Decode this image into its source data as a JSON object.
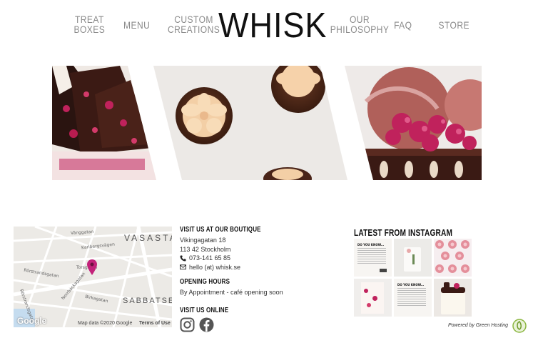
{
  "nav": {
    "treat_boxes": [
      "TREAT",
      "BOXES"
    ],
    "menu": "MENU",
    "custom_creations": [
      "CUSTOM",
      "CREATIONS"
    ],
    "logo": "WHISK",
    "our_philosophy": [
      "OUR",
      "PHILOSOPHY"
    ],
    "faq": "FAQ",
    "store": "STORE"
  },
  "map": {
    "districts": [
      "VASASTA",
      "SABBATSE"
    ],
    "streets": [
      "Vänggatan",
      "Karlbergsvägen",
      "Torsgatan",
      "Birkagatan",
      "Rörstrandsgatan",
      "Norrbackagatan",
      "Sankt Eriksgatan",
      "Rörstrandsgatan"
    ],
    "google": "Google",
    "attribution": "Map data ©2020 Google",
    "terms": "Terms of Use"
  },
  "boutique": {
    "heading": "VISIT US AT OUR BOUTIQUE",
    "street": "Vikingagatan 18",
    "city": "113 42 Stockholm",
    "phone": "073-141 65 85",
    "email": "hello (at) whisk.se"
  },
  "hours": {
    "heading": "OPENING HOURS",
    "text": "By Appointment - café opening soon"
  },
  "online": {
    "heading": "VISIT US ONLINE",
    "icons": [
      "instagram-icon",
      "facebook-icon"
    ]
  },
  "instagram": {
    "heading": "LATEST FROM INSTAGRAM",
    "tile_text": "DO YOU KNOW..."
  },
  "footer": {
    "powered_by": "Powered by Green Hosting"
  },
  "colors": {
    "nav_text": "#8a8a8a",
    "logo": "#111111",
    "map_pin": "#c2227a",
    "raspberry": "#c0225c",
    "chocolate": "#3a1a14"
  }
}
